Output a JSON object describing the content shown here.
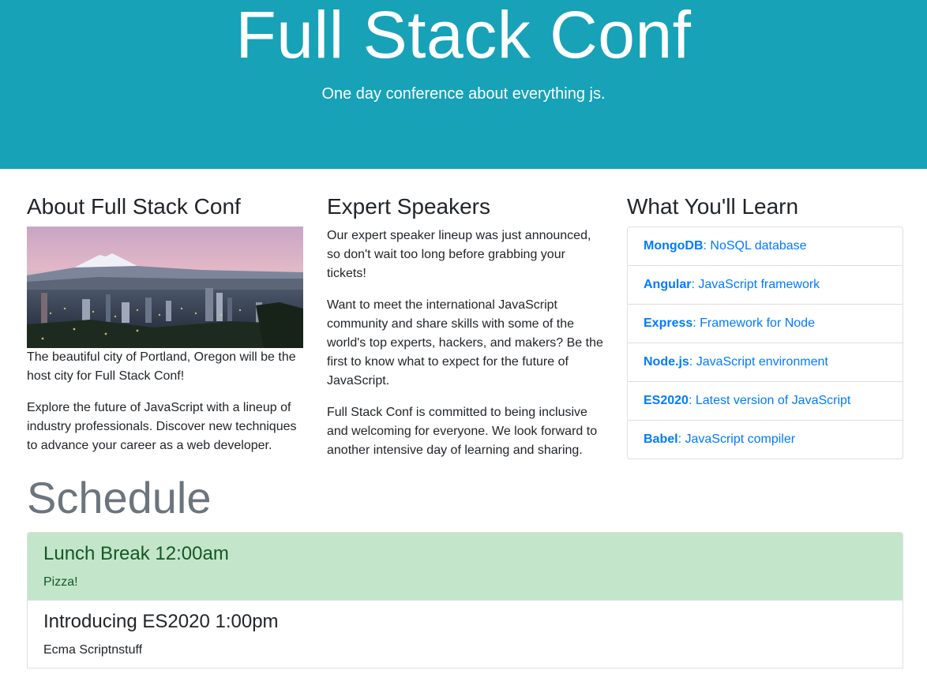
{
  "hero": {
    "title": "Full Stack Conf",
    "subtitle": "One day conference about everything js.",
    "background_color": "#17a2b8"
  },
  "about": {
    "heading": "About Full Stack Conf",
    "image_alt": "Portland skyline with Mount Hood",
    "paragraphs": [
      "The beautiful city of Portland, Oregon will be the host city for Full Stack Conf!",
      "Explore the future of JavaScript with a lineup of industry professionals. Discover new techniques to advance your career as a web developer."
    ]
  },
  "speakers": {
    "heading": "Expert Speakers",
    "paragraphs": [
      "Our expert speaker lineup was just announced, so don't wait too long before grabbing your tickets!",
      "Want to meet the international JavaScript community and share skills with some of the world's top experts, hackers, and makers? Be the first to know what to expect for the future of JavaScript.",
      "Full Stack Conf is committed to being inclusive and welcoming for everyone. We look forward to another intensive day of learning and sharing."
    ]
  },
  "learn": {
    "heading": "What You'll Learn",
    "link_color": "#007bff",
    "items": [
      {
        "name": "MongoDB",
        "desc": ": NoSQL database"
      },
      {
        "name": "Angular",
        "desc": ": JavaScript framework"
      },
      {
        "name": "Express",
        "desc": ": Framework for Node"
      },
      {
        "name": "Node.js",
        "desc": ": JavaScript environment"
      },
      {
        "name": "ES2020",
        "desc": ": Latest version of JavaScript"
      },
      {
        "name": "Babel",
        "desc": ": JavaScript compiler"
      }
    ]
  },
  "schedule": {
    "title": "Schedule",
    "highlight_color": "#c3e6cb",
    "items": [
      {
        "title": "Lunch Break 12:00am",
        "desc": "Pizza!"
      },
      {
        "title": "Introducing ES2020 1:00pm",
        "desc": "Ecma Scriptnstuff"
      }
    ]
  }
}
